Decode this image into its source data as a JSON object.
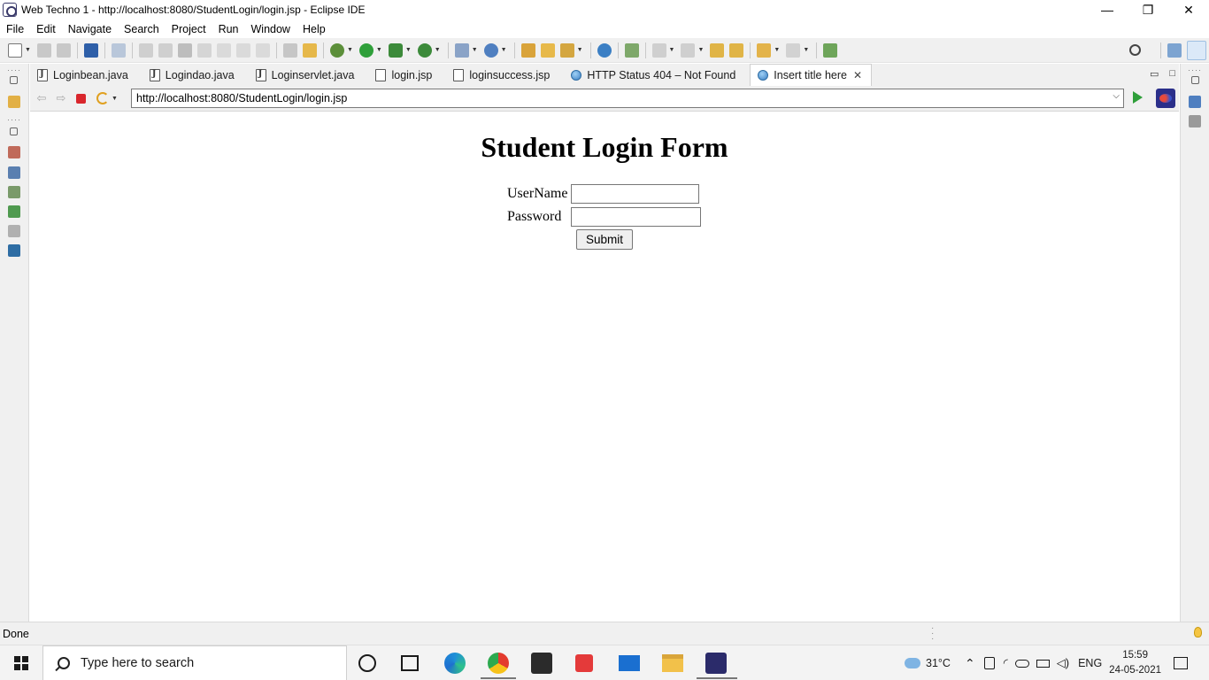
{
  "window": {
    "title": "Web Techno 1 - http://localhost:8080/StudentLogin/login.jsp - Eclipse IDE",
    "minimize": "—",
    "restore": "❐",
    "close": "✕"
  },
  "menu": {
    "items": [
      "File",
      "Edit",
      "Navigate",
      "Search",
      "Project",
      "Run",
      "Window",
      "Help"
    ]
  },
  "tabs": [
    {
      "label": "Loginbean.java",
      "icon": "java-file-icon"
    },
    {
      "label": "Logindao.java",
      "icon": "java-file-icon"
    },
    {
      "label": "Loginservlet.java",
      "icon": "java-file-icon"
    },
    {
      "label": "login.jsp",
      "icon": "jsp-file-icon"
    },
    {
      "label": "loginsuccess.jsp",
      "icon": "jsp-file-icon"
    },
    {
      "label": "HTTP Status 404 – Not Found",
      "icon": "globe-icon"
    },
    {
      "label": "Insert title here",
      "icon": "globe-icon",
      "active": true
    }
  ],
  "browser": {
    "url": "http://localhost:8080/StudentLogin/login.jsp"
  },
  "page": {
    "heading": "Student Login Form",
    "username_label": "UserName",
    "username_value": "",
    "password_label": "Password",
    "password_value": "",
    "submit_label": "Submit"
  },
  "status": {
    "text": "Done"
  },
  "taskbar": {
    "search_placeholder": "Type here to search",
    "temperature": "31°C",
    "language": "ENG",
    "time": "15:59",
    "date": "24-05-2021"
  },
  "colors": {
    "accent": "#2f9f3a",
    "stop": "#d9262c",
    "toolbar_bg": "#f0f0f0"
  }
}
